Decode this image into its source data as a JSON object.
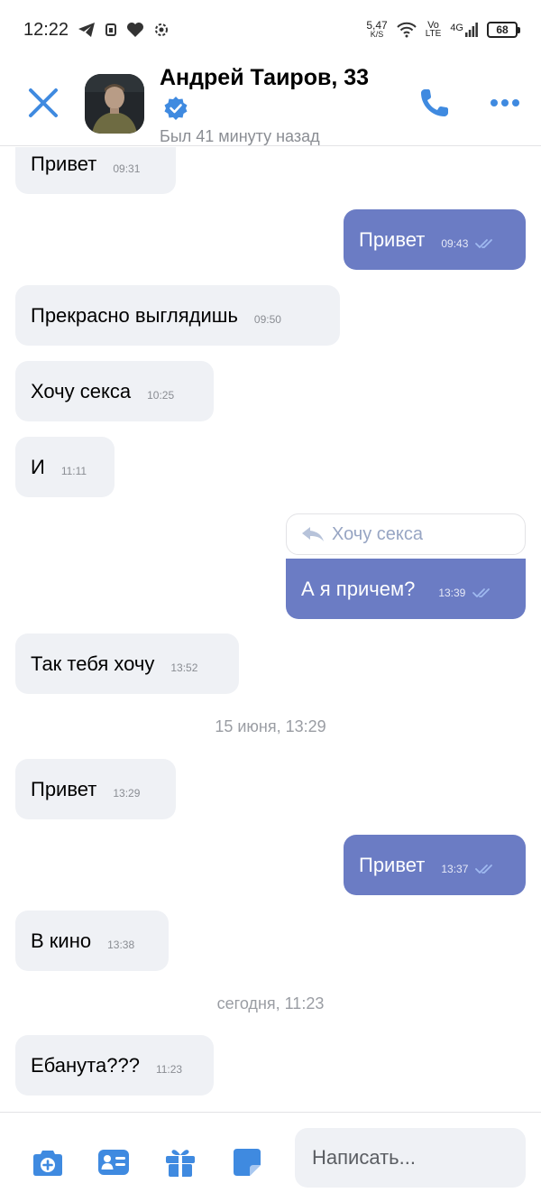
{
  "status_bar": {
    "time": "12:22",
    "net_speed_value": "5,47",
    "net_speed_unit": "K/S",
    "volte_top": "Vo",
    "volte_bottom": "LTE",
    "network": "4G",
    "battery": "68"
  },
  "header": {
    "name": "Андрей Таиров, 33",
    "last_seen": "Был 41 минуту назад"
  },
  "messages": [
    {
      "dir": "in",
      "text": "Привет",
      "time": "09:31"
    },
    {
      "dir": "out",
      "text": "Привет",
      "time": "09:43"
    },
    {
      "dir": "in",
      "text": "Прекрасно выглядишь",
      "time": "09:50"
    },
    {
      "dir": "in",
      "text": "Хочу секса",
      "time": "10:25"
    },
    {
      "dir": "in",
      "text": "И",
      "time": "11:11"
    },
    {
      "dir": "out",
      "text": "А я причем?",
      "time": "13:39",
      "reply_to": "Хочу секса"
    },
    {
      "dir": "in",
      "text": "Так тебя хочу",
      "time": "13:52"
    },
    {
      "dir": "in",
      "text": "Привет",
      "time": "13:29"
    },
    {
      "dir": "out",
      "text": "Привет",
      "time": "13:37"
    },
    {
      "dir": "in",
      "text": "В кино",
      "time": "13:38"
    },
    {
      "dir": "in",
      "text": "Ебанута???",
      "time": "11:23"
    }
  ],
  "date_separators": [
    "15 июня, 13:29",
    "сегодня, 11:23"
  ],
  "composer": {
    "placeholder": "Написать..."
  },
  "colors": {
    "accent": "#3f8ae0",
    "outgoing_bubble": "#6b7cc4",
    "incoming_bubble": "#eff1f5"
  }
}
